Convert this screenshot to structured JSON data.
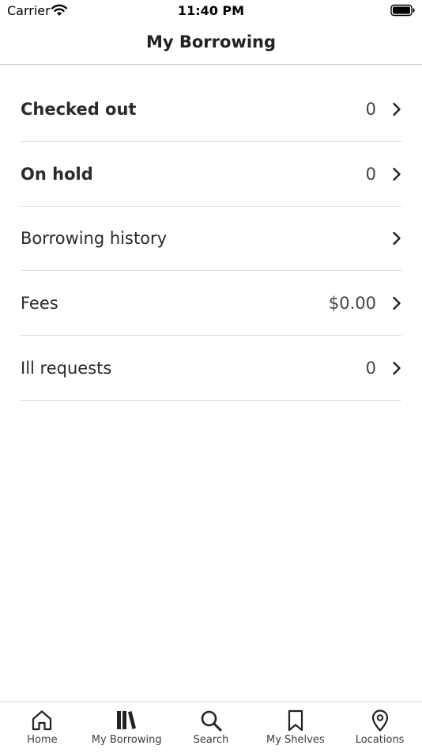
{
  "status_bar": {
    "carrier": "Carrier",
    "time": "11:40 PM",
    "wifi_icon": "wifi-icon",
    "battery_icon": "battery-icon"
  },
  "header": {
    "title": "My Borrowing"
  },
  "rows": [
    {
      "label": "Checked out",
      "value": "0",
      "bold": true
    },
    {
      "label": "On hold",
      "value": "0",
      "bold": true
    },
    {
      "label": "Borrowing history",
      "value": "",
      "bold": false
    },
    {
      "label": "Fees",
      "value": "$0.00",
      "bold": false
    },
    {
      "label": "Ill requests",
      "value": "0",
      "bold": false
    }
  ],
  "tab_bar": {
    "tabs": [
      {
        "label": "Home",
        "icon": "home-icon"
      },
      {
        "label": "My Borrowing",
        "icon": "books-icon",
        "selected": true
      },
      {
        "label": "Search",
        "icon": "search-icon"
      },
      {
        "label": "My Shelves",
        "icon": "bookmark-icon"
      },
      {
        "label": "Locations",
        "icon": "location-pin-icon"
      }
    ]
  },
  "colors": {
    "text": "#222222",
    "divider": "#dcdcdc",
    "background": "#ffffff"
  }
}
